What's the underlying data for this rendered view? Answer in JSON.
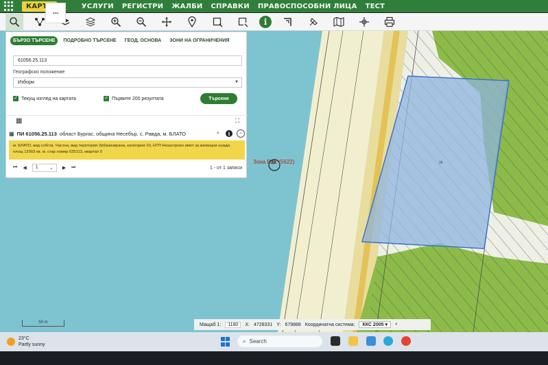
{
  "menu": {
    "items": [
      "КАРТА",
      "УСЛУГИ",
      "РЕГИСТРИ",
      "ЖАЛБИ",
      "СПРАВКИ",
      "ПРАВОСПОСОБНИ ЛИЦА",
      "ТЕСТ"
    ],
    "active_index": 0
  },
  "toolbar": {
    "tools": [
      "search-icon",
      "network-icon",
      "layers-stack-icon",
      "layers-icon",
      "zoom-in-icon",
      "zoom-out-icon",
      "pan-icon",
      "marker-icon",
      "select-rectangle-icon",
      "select-edit-icon",
      "info-icon",
      "measure-icon",
      "draw-icon",
      "map-icon",
      "coordinates-icon",
      "print-icon"
    ],
    "info_glyph": "i"
  },
  "panel": {
    "tabs": [
      "БЪРЗО ТЪРСЕНЕ",
      "ПОДРОБНО ТЪРСЕНЕ",
      "ГЕОД. ОСНОВА",
      "ЗОНИ НА ОГРАНИЧЕНИЯ"
    ],
    "search_value": "61056.25.113",
    "geo_label": "Географско положение",
    "geo_value": "Избори",
    "check_current_view": "Текущ изглед на картата",
    "check_first_200": "Първите 200 резултата",
    "search_button": "Търсене",
    "result_title": "ПИ 61056.25.113",
    "result_location": "област Бургас, община Несебър, с. Равда, м. БЛАТО",
    "result_desc": "м. БЛАТО, вид собств. Частна, вид територия Урбанизирана, категория 10, НТП Незастроен имот за жилищни нужди, площ 12003 кв. м, стар номер 025113, квартал 0",
    "page_value": "1",
    "page_count": "1 - от 1 записи"
  },
  "map": {
    "zone_label": "Зона В (1 (5622)",
    "zone_marker": "20",
    "scale_label": "50 m",
    "parcel_label": "25",
    "colors": {
      "sea": "#7ec3d0",
      "beach": "#f2efd0",
      "road": "#e6cf6a",
      "green": "#8dbb4a",
      "parcel_fill": "#8fb4e0",
      "parcel_border": "#3a74c9"
    }
  },
  "statusbar": {
    "scale_label": "Мащаб 1:",
    "scale_value": "1180",
    "x_label": "X:",
    "x_value": "4728331",
    "y_label": "Y:",
    "y_value": "679888",
    "crs_label": "Координатна система:",
    "crs_value": "ККС 2005"
  },
  "taskbar": {
    "temperature": "23°C",
    "weather": "Partly sunny",
    "search_placeholder": "Search"
  }
}
